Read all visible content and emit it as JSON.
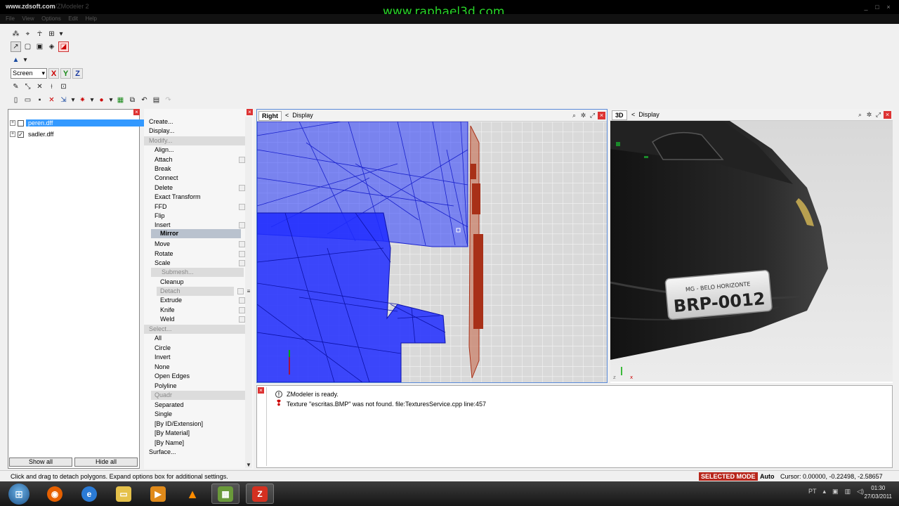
{
  "window": {
    "title_url": "www.zdsoft.com",
    "title_rest": "/ZModeler 2",
    "watermark": "www.raphael3d.com"
  },
  "menu": [
    "File",
    "View",
    "Options",
    "Edit",
    "Help"
  ],
  "toolbar": {
    "coord_select": "Screen",
    "axes": [
      "X",
      "Y",
      "Z"
    ]
  },
  "tree": {
    "items": [
      {
        "label": "peren.dff",
        "checked": false,
        "selected": true
      },
      {
        "label": "sadler.dff",
        "checked": true,
        "selected": false
      }
    ],
    "show_all": "Show all",
    "hide_all": "Hide all"
  },
  "commands": [
    "Create...",
    "Display...",
    "Modify...",
    "Align...",
    "Attach",
    "Break",
    "Connect",
    "Delete",
    "Exact Transform",
    "FFD",
    "Flip",
    "Insert",
    "Mirror",
    "Move",
    "Rotate",
    "Scale",
    "Submesh...",
    "Cleanup",
    "Detach",
    "Extrude",
    "Knife",
    "Weld",
    "Select...",
    "All",
    "Circle",
    "Invert",
    "None",
    "Open Edges",
    "Polyline",
    "Quadr",
    "Separated",
    "Single",
    "[By ID/Extension]",
    "[By Material]",
    "[By Name]",
    "Surface..."
  ],
  "viewports": {
    "right": {
      "name": "Right",
      "display": "Display"
    },
    "three_d": {
      "name": "3D",
      "display": "Display"
    }
  },
  "plate": {
    "region": "MG - BELO HORIZONTE",
    "number": "BRP-0012"
  },
  "log": [
    {
      "type": "info",
      "text": "ZModeler is ready."
    },
    {
      "type": "error",
      "text": "Texture \"escritas.BMP\" was not found. file:TexturesService.cpp line:457"
    }
  ],
  "status": {
    "hint": "Click and drag to detach polygons. Expand options box for additional settings.",
    "mode": "SELECTED MODE",
    "auto": "Auto",
    "cursor": "Cursor: 0.00000, -0.22498, -2.58657"
  },
  "taskbar": {
    "lang": "PT",
    "time": "01:30",
    "date": "27/03/2011"
  },
  "colors": {
    "mesh_blue": "#1f2bff",
    "mesh_red": "#a83018",
    "mode_badge": "#b8261b",
    "watermark": "#29d629"
  }
}
